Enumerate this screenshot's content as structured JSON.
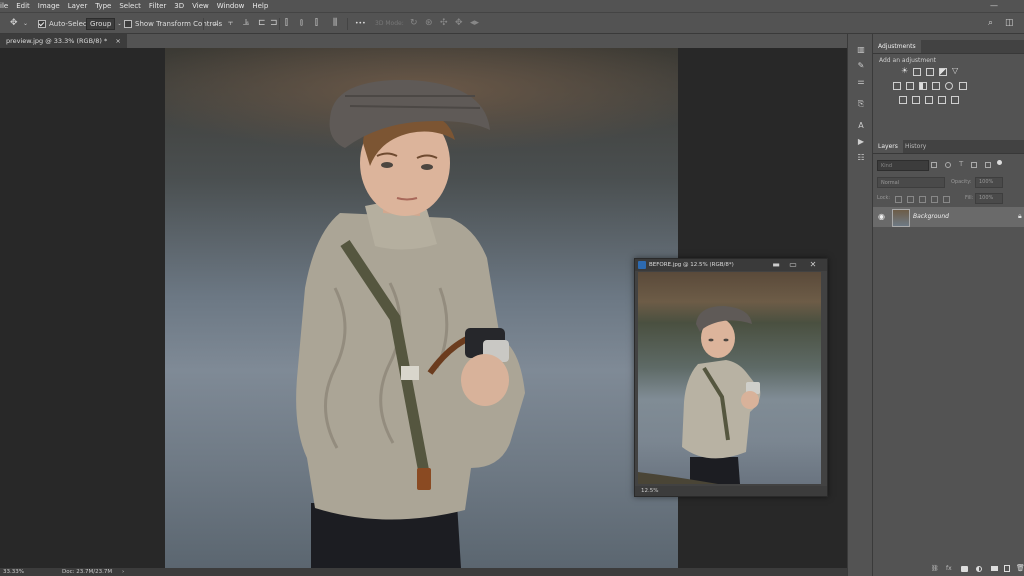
{
  "menu": [
    "ile",
    "Edit",
    "Image",
    "Layer",
    "Type",
    "Select",
    "Filter",
    "3D",
    "View",
    "Window",
    "Help"
  ],
  "options": {
    "auto_select_label": "Auto-Select",
    "group_value": "Group",
    "transform_label": "Show Transform Controls",
    "more_label": "•••",
    "mode_3d_label": "3D Mode:"
  },
  "document": {
    "tab_label": "preview.jpg @ 33.3% (RGB/8) *",
    "tab_close": "×",
    "zoom": "33.33%",
    "doc_size": "Doc: 23.7M/23.7M",
    "status_arrow": "›"
  },
  "before_window": {
    "title": "BEFORE.jpg @ 12.5% (RGB/8*)",
    "zoom": "12.5%",
    "minimize": "▬",
    "restore": "▭",
    "close": "✕"
  },
  "adjustments": {
    "tab_label": "Adjustments",
    "add_label": "Add an adjustment"
  },
  "layers": {
    "tab_layers": "Layers",
    "tab_history": "History",
    "kind_placeholder": "Kind",
    "blend_mode": "Normal",
    "opacity_label": "Opacity:",
    "opacity_value": "100%",
    "lock_label": "Lock:",
    "fill_label": "Fill:",
    "fill_value": "100%",
    "items": [
      {
        "name": "Background",
        "visible": true
      }
    ]
  },
  "colors": {
    "workspace": "#282828",
    "chrome": "#535353",
    "panel_dark": "#424242",
    "layer_selected": "#6a6a6a"
  }
}
